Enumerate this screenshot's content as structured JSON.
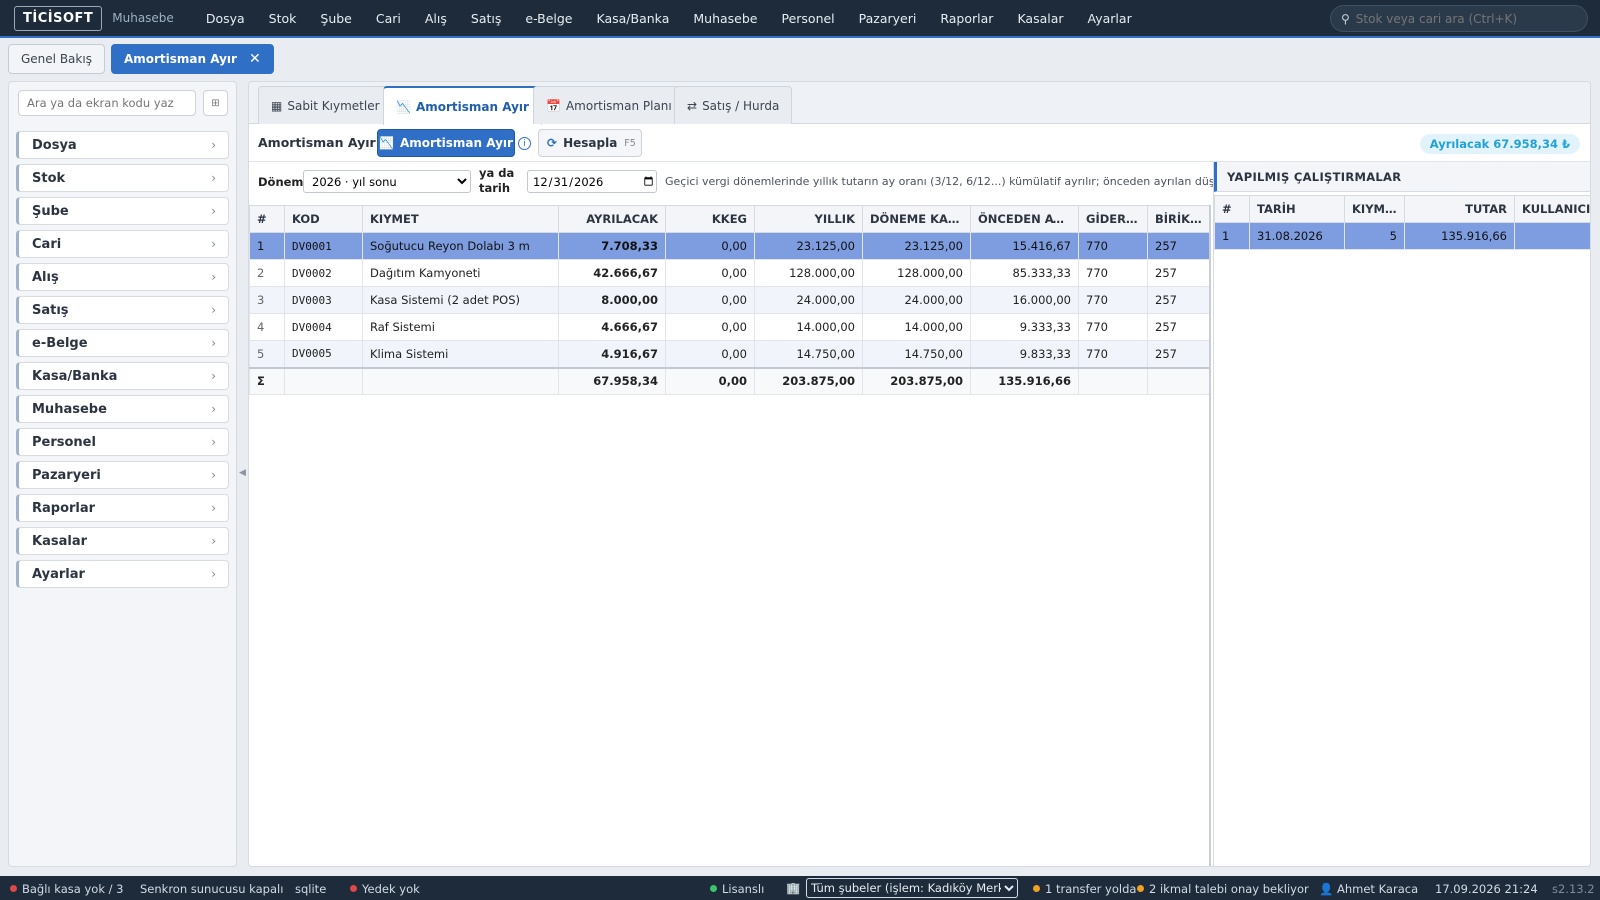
{
  "app": {
    "logo": "TİCİSOFT",
    "name": "Muhasebe"
  },
  "menu": [
    "Dosya",
    "Stok",
    "Şube",
    "Cari",
    "Alış",
    "Satış",
    "e-Belge",
    "Kasa/Banka",
    "Muhasebe",
    "Personel",
    "Pazaryeri",
    "Raporlar",
    "Kasalar",
    "Ayarlar"
  ],
  "search": {
    "placeholder": "Stok veya cari ara (Ctrl+K)"
  },
  "page_tabs": {
    "overview": "Genel Bakış",
    "active": "Amortisman Ayır",
    "close": "✕"
  },
  "sidebar": {
    "search_placeholder": "Ara ya da ekran kodu yaz",
    "grid_icon": "⊞",
    "items": [
      "Dosya",
      "Stok",
      "Şube",
      "Cari",
      "Alış",
      "Satış",
      "e-Belge",
      "Kasa/Banka",
      "Muhasebe",
      "Personel",
      "Pazaryeri",
      "Raporlar",
      "Kasalar",
      "Ayarlar"
    ],
    "chevron": "›"
  },
  "subtabs": [
    {
      "label": "Sabit Kıymetler",
      "icon": "▦"
    },
    {
      "label": "Amortisman Ayır",
      "icon": "📉"
    },
    {
      "label": "Amortisman Planı",
      "icon": "📅"
    },
    {
      "label": "Satış / Hurda",
      "icon": "⇄"
    }
  ],
  "toolbar": {
    "title": "Amortisman Ayır",
    "primary_button": "Amortisman Ayır",
    "info": "i",
    "calc_button": "Hesapla",
    "calc_key": "F5",
    "badge": "Ayrılacak 67.958,34 ₺"
  },
  "filter": {
    "period_label": "Dönem",
    "period_selected": "2026 · yıl sonu",
    "or_date_label": "ya da tarih",
    "date_value": "2026-12-31",
    "note": "Geçici vergi dönemlerinde yıllık tutarın ay oranı (3/12, 6/12...) kümülatif ayrılır; önceden ayrılan düşülür."
  },
  "table": {
    "headers": [
      "#",
      "KOD",
      "KIYMET",
      "AYRILACAK",
      "KKEG",
      "YILLIK",
      "DÖNEME KADAR",
      "ÖNCEDEN AYRILAN",
      "GİDER HESABI",
      "BİRİKMİŞ AMORTİSMAN"
    ],
    "rows": [
      [
        "1",
        "DV0001",
        "Soğutucu Reyon Dolabı 3 m",
        "7.708,33",
        "0,00",
        "23.125,00",
        "23.125,00",
        "15.416,67",
        "770",
        "257"
      ],
      [
        "2",
        "DV0002",
        "Dağıtım Kamyoneti",
        "42.666,67",
        "0,00",
        "128.000,00",
        "128.000,00",
        "85.333,33",
        "770",
        "257"
      ],
      [
        "3",
        "DV0003",
        "Kasa Sistemi (2 adet POS)",
        "8.000,00",
        "0,00",
        "24.000,00",
        "24.000,00",
        "16.000,00",
        "770",
        "257"
      ],
      [
        "4",
        "DV0004",
        "Raf Sistemi",
        "4.666,67",
        "0,00",
        "14.000,00",
        "14.000,00",
        "9.333,33",
        "770",
        "257"
      ],
      [
        "5",
        "DV0005",
        "Klima Sistemi",
        "4.916,67",
        "0,00",
        "14.750,00",
        "14.750,00",
        "9.833,33",
        "770",
        "257"
      ]
    ],
    "totals": [
      "Σ",
      "",
      "",
      "67.958,34",
      "0,00",
      "203.875,00",
      "203.875,00",
      "135.916,66",
      "",
      ""
    ]
  },
  "runs": {
    "title": "YAPILMIŞ ÇALIŞTIRMALAR",
    "headers": [
      "#",
      "TARİH",
      "KIYMET SAYISI",
      "TUTAR",
      "KULLANICI"
    ],
    "rows": [
      [
        "1",
        "31.08.2026",
        "5",
        "135.916,66",
        ""
      ]
    ]
  },
  "status": {
    "cash": "Bağlı kasa yok / 3",
    "sync": "Senkron sunucusu kapalı",
    "db": "sqlite",
    "backup": "Yedek yok",
    "license": "Lisanslı",
    "branch_selected": "Tüm şubeler (işlem: Kadıköy Merkez)",
    "transfer": "1 transfer yolda",
    "supply": "2 ikmal talebi onay bekliyor",
    "user": "Ahmet Karaca",
    "datetime": "17.09.2026 21:24",
    "version": "s2.13.2"
  },
  "colors": {
    "accent": "#2f6fc6",
    "topbar": "#1d2b3a",
    "selected_row": "#7e9de0",
    "badge_text": "#22a2d6",
    "dot_red": "#e04848",
    "dot_green": "#3cc46a",
    "dot_orange": "#f0a020"
  }
}
